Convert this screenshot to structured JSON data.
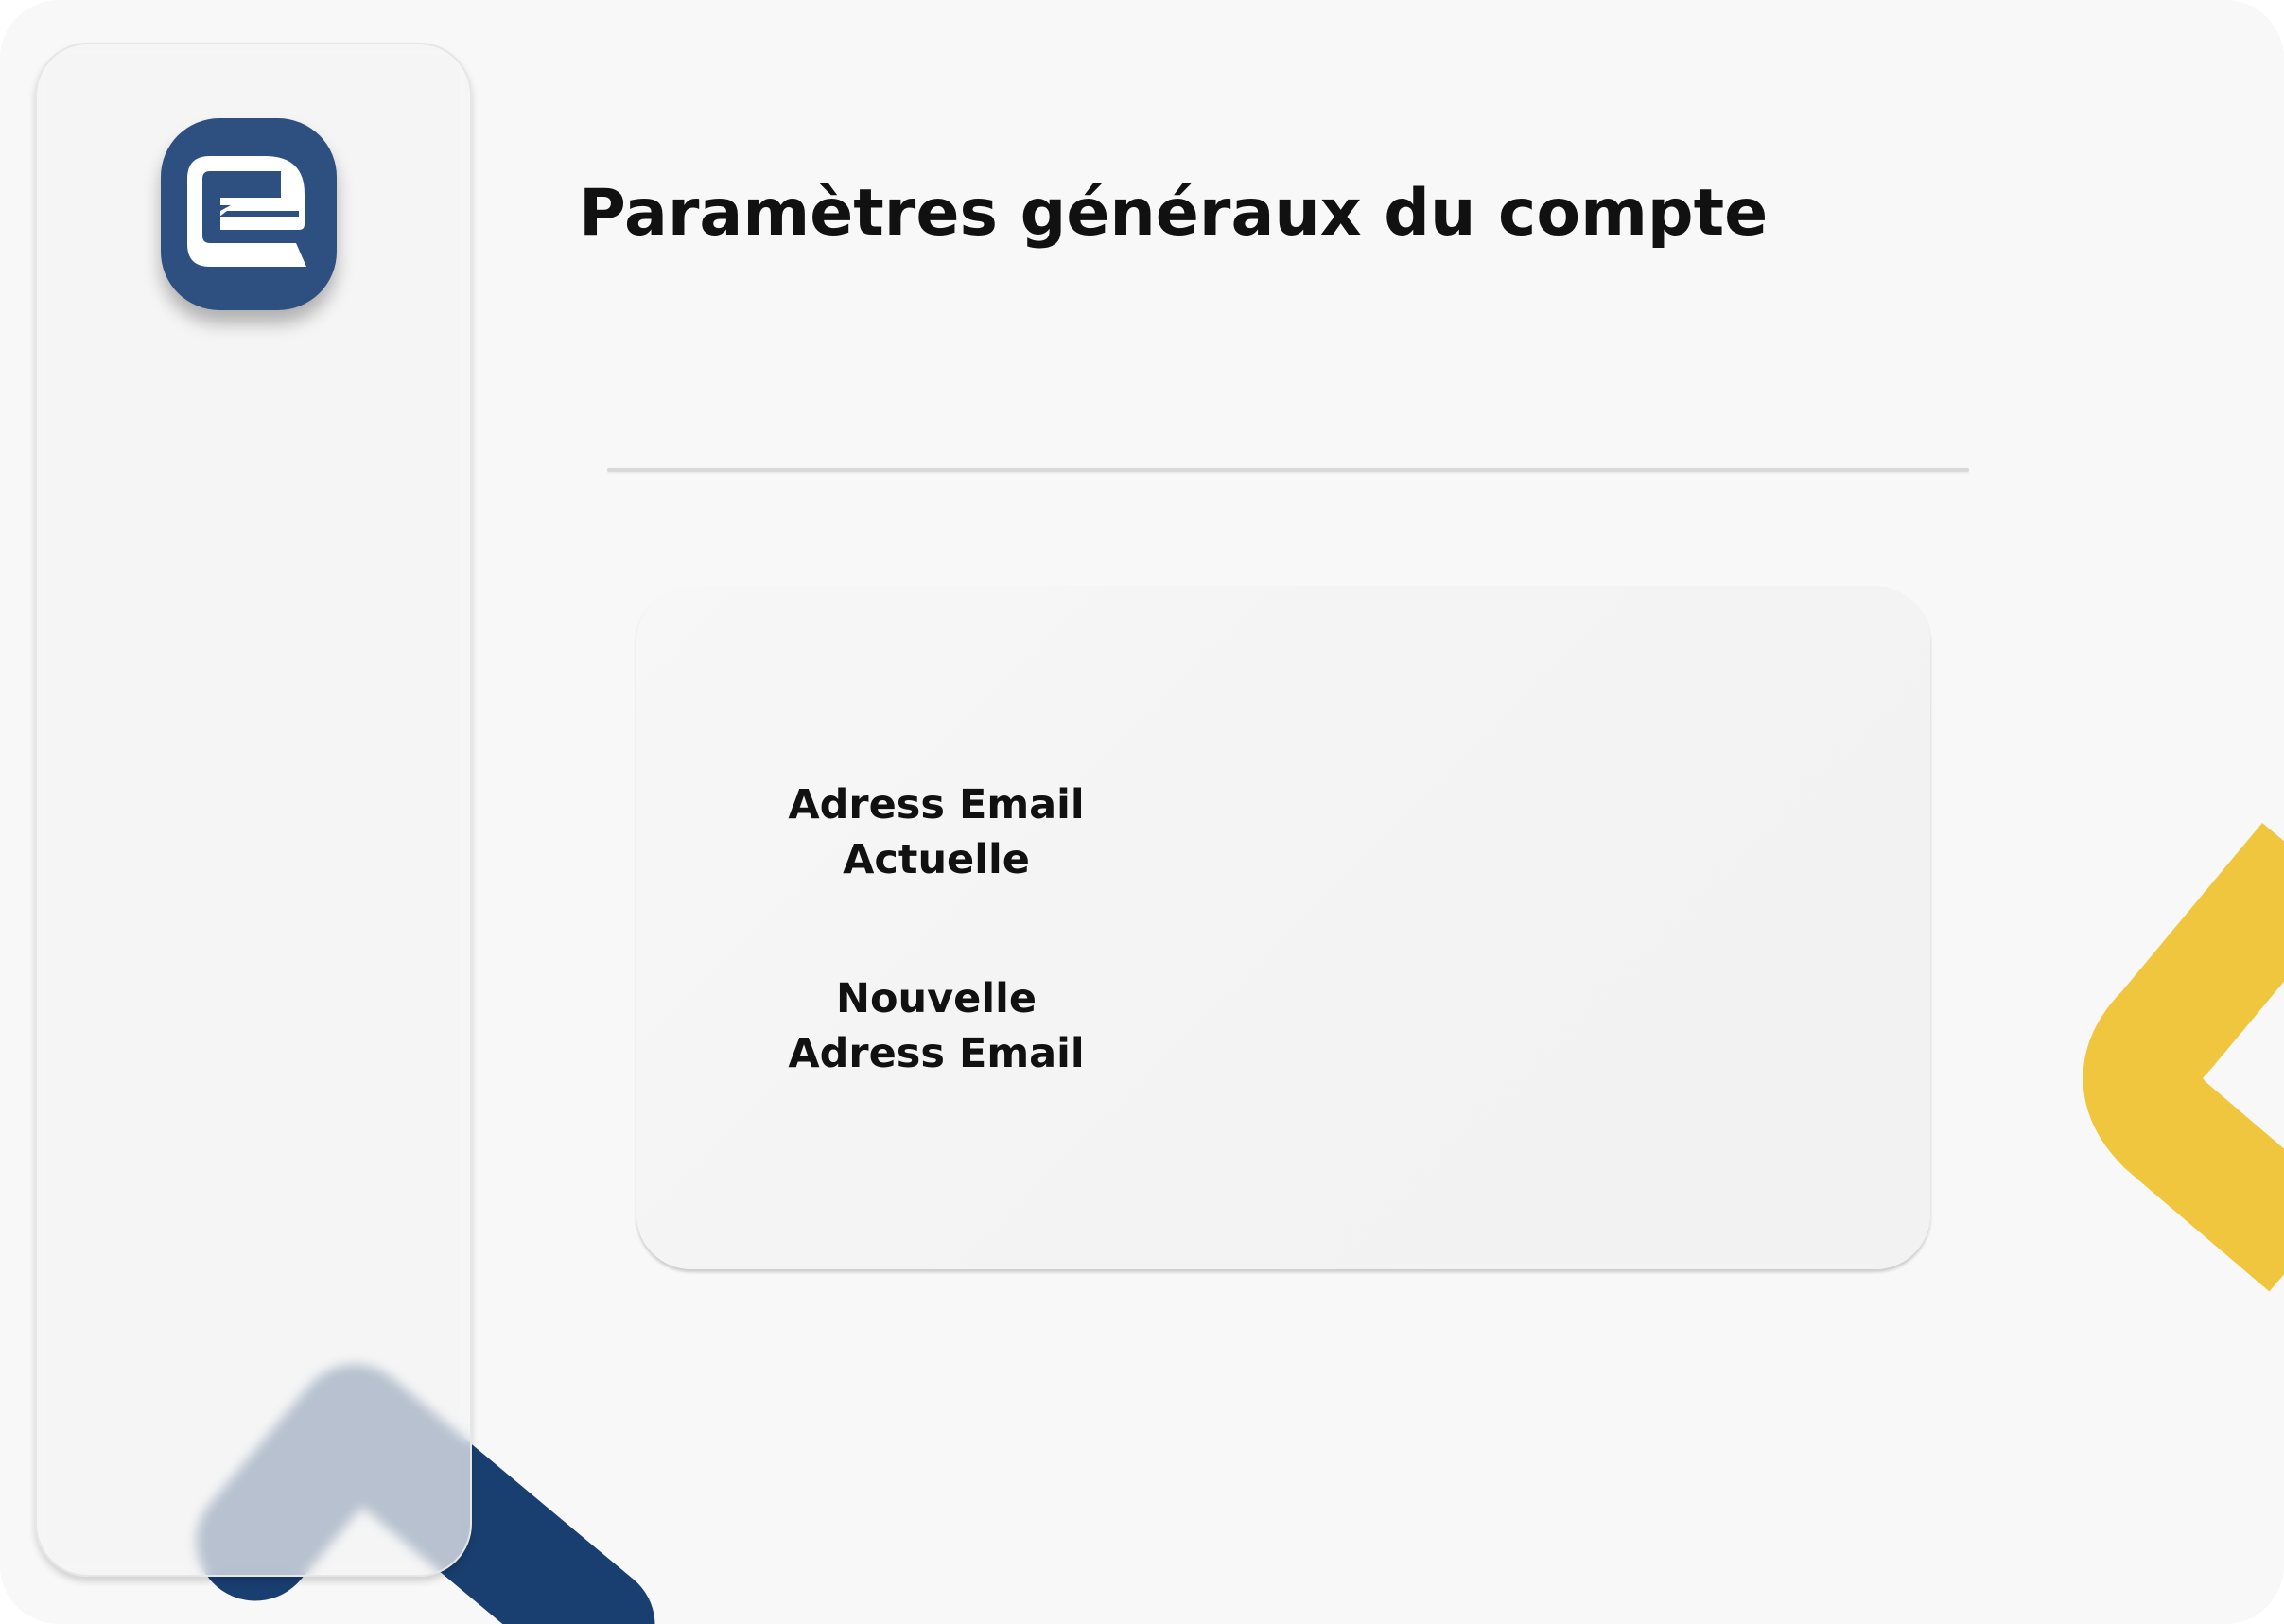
{
  "app": {
    "logo_icon": "app-logo-icon",
    "brand_color": "#2e5081",
    "accent_blue": "#193f70",
    "accent_yellow": "#f0c63f"
  },
  "header": {
    "title": "Paramètres généraux du compte"
  },
  "form": {
    "current_email_label": {
      "line1": "Adress Email",
      "line2": "Actuelle"
    },
    "new_email_label": {
      "line1": "Nouvelle",
      "line2": "Adress Email"
    }
  }
}
